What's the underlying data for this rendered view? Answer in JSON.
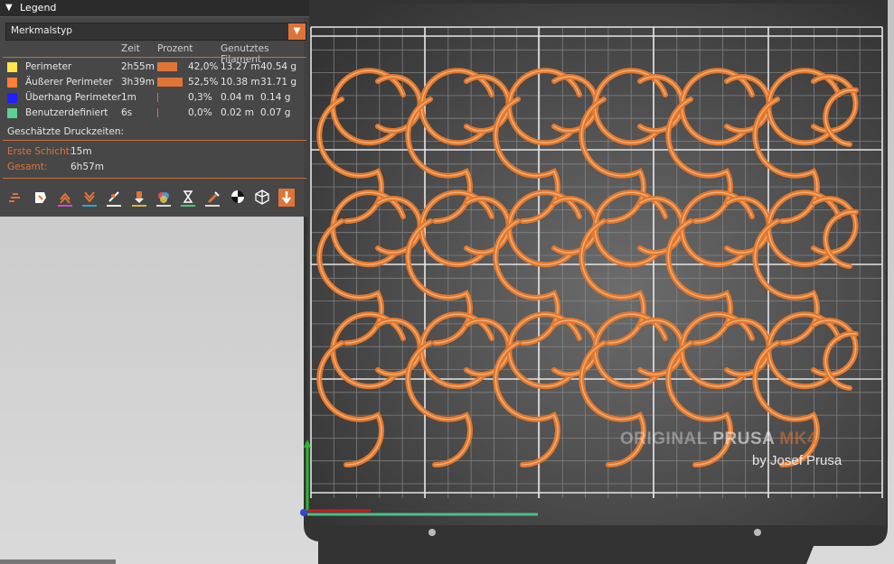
{
  "legend": {
    "title": "Legend",
    "feature_type": "Merkmalstyp",
    "columns": {
      "time": "Zeit",
      "percent": "Prozent",
      "filament": "Genutztes Filament"
    },
    "rows": [
      {
        "label": "Perimeter",
        "time": "2h55m",
        "percent": "42,0%",
        "percent_value": 42.0,
        "length": "13.27 m",
        "weight": "40.54 g",
        "color": "#ffe64d"
      },
      {
        "label": "Äußerer Perimeter",
        "time": "3h39m",
        "percent": "52,5%",
        "percent_value": 52.5,
        "length": "10.38 m",
        "weight": "31.71 g",
        "color": "#ff7d38"
      },
      {
        "label": "Überhang Perimeter",
        "time": "1m",
        "percent": "0,3%",
        "percent_value": 0.3,
        "length": "0.04 m",
        "weight": "0.14 g",
        "color": "#1f1fff"
      },
      {
        "label": "Benutzerdefiniert",
        "time": "6s",
        "percent": "0,0%",
        "percent_value": 0.0,
        "length": "0.02 m",
        "weight": "0.07 g",
        "color": "#5ed194"
      }
    ],
    "estimated_times_title": "Geschätzte Druckzeiten:",
    "first_layer_label": "Erste Schicht:",
    "first_layer_value": "15m",
    "total_label": "Gesamt:",
    "total_value": "6h57m"
  },
  "toolbar": {
    "icons": [
      {
        "name": "travel-icon",
        "underline": "none"
      },
      {
        "name": "wipe-icon",
        "underline": "none"
      },
      {
        "name": "retractions-icon",
        "underline": "#c94fd0"
      },
      {
        "name": "deretractions-icon",
        "underline": "#3fa0c6"
      },
      {
        "name": "seams-icon",
        "underline": "#e8e8e8"
      },
      {
        "name": "tool-changes-icon",
        "underline": "#d6b64c"
      },
      {
        "name": "color-changes-icon",
        "underline": "#d9d9d9"
      },
      {
        "name": "pause-prints-icon",
        "underline": "#4cc777"
      },
      {
        "name": "custom-gcodes-icon",
        "underline": "#d9d9d9"
      },
      {
        "name": "center-of-gravity-icon",
        "underline": "none"
      },
      {
        "name": "shells-icon",
        "underline": "none"
      },
      {
        "name": "tool-marker-icon",
        "underline": "none"
      }
    ]
  },
  "bed": {
    "brand_part1": "ORIGINAL ",
    "brand_part2": "PRUSA ",
    "brand_part3": "MK4",
    "brand_sub": "by Josef Prusa",
    "accent": "#e07436",
    "filament_color": "#e2782f"
  }
}
